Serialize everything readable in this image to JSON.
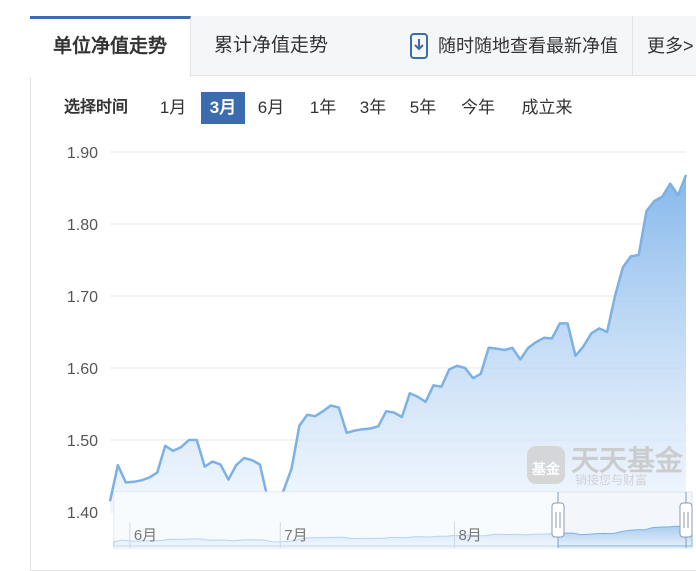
{
  "tabs": {
    "unit_nav": "单位净值走势",
    "cumulative_nav": "累计净值走势",
    "mobile_link": "随时随地查看最新净值",
    "more": "更多>"
  },
  "range": {
    "label": "选择时间",
    "options": [
      "1月",
      "3月",
      "6月",
      "1年",
      "3年",
      "5年",
      "今年",
      "成立来"
    ],
    "selected": "3月"
  },
  "watermark": {
    "title": "天天基金",
    "subtitle": "销接您与财富",
    "logo_text": "基金"
  },
  "colors": {
    "accent": "#3b6cad",
    "line": "#7cb1e6",
    "area_top": "#7fb4ea",
    "area_bottom": "#e8f1fc"
  },
  "chart_data": {
    "type": "area",
    "title": "",
    "xlabel": "",
    "ylabel": "",
    "ylim": [
      1.39,
      1.9
    ],
    "yticks": [
      "1.90",
      "1.80",
      "1.70",
      "1.60",
      "1.50",
      "1.40"
    ],
    "grid": true,
    "navigator_ticks": [
      {
        "label": "6月",
        "index": 2
      },
      {
        "label": "7月",
        "index": 21
      },
      {
        "label": "8月",
        "index": 43
      }
    ],
    "series": [
      {
        "values": [
          1.415,
          1.465,
          1.441,
          1.442,
          1.444,
          1.448,
          1.455,
          1.492,
          1.485,
          1.49,
          1.5,
          1.5,
          1.463,
          1.47,
          1.466,
          1.445,
          1.465,
          1.475,
          1.472,
          1.466,
          1.418,
          1.414,
          1.43,
          1.46,
          1.52,
          1.535,
          1.533,
          1.54,
          1.548,
          1.545,
          1.51,
          1.513,
          1.515,
          1.516,
          1.519,
          1.54,
          1.538,
          1.532,
          1.565,
          1.56,
          1.553,
          1.576,
          1.574,
          1.598,
          1.603,
          1.6,
          1.586,
          1.592,
          1.628,
          1.627,
          1.625,
          1.628,
          1.612,
          1.628,
          1.636,
          1.642,
          1.641,
          1.662,
          1.662,
          1.617,
          1.63,
          1.648,
          1.655,
          1.65,
          1.7,
          1.74,
          1.755,
          1.757,
          1.818,
          1.832,
          1.838,
          1.856,
          1.84,
          1.868
        ]
      }
    ]
  }
}
